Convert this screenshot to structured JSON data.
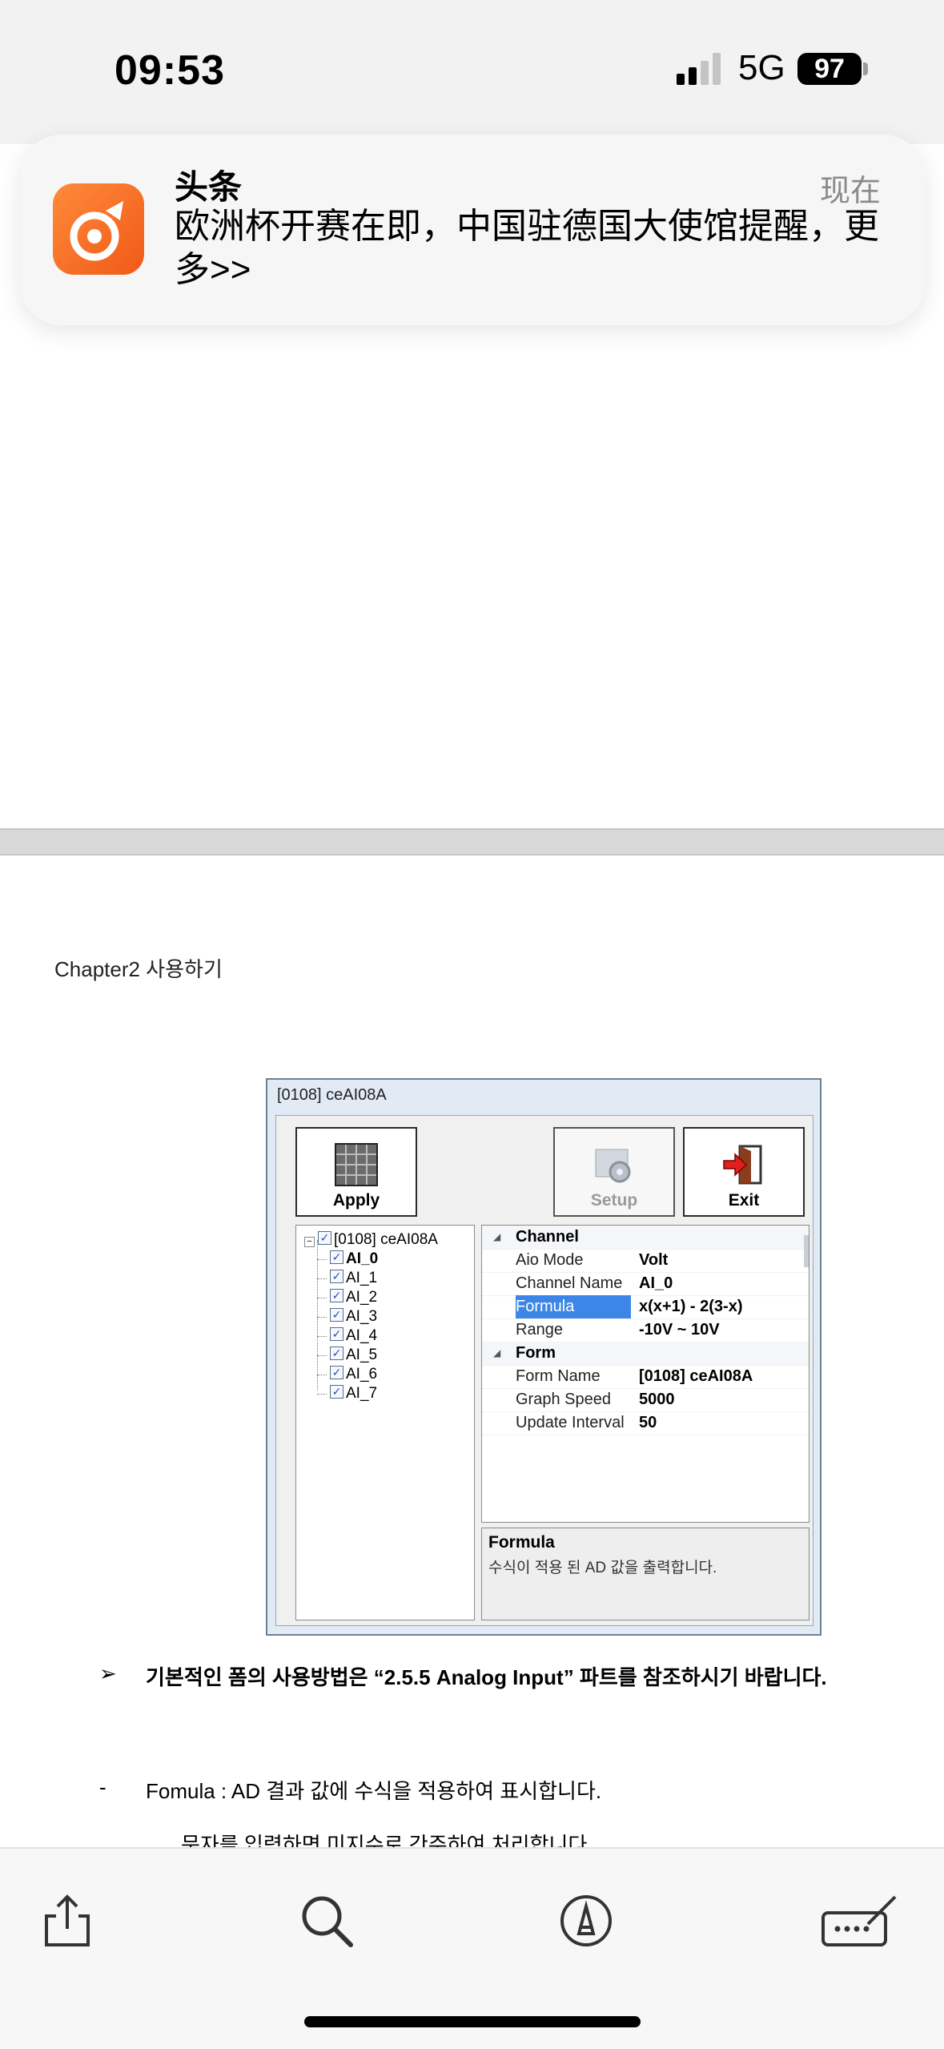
{
  "status_bar": {
    "time": "09:53",
    "network": "5G",
    "battery": "97"
  },
  "notification": {
    "app": "头条",
    "time": "现在",
    "body": "欧洲杯开赛在即，中国驻德国大使馆提醒，更多>>"
  },
  "document": {
    "chapter_header": "Chapter2  사용하기",
    "window": {
      "title": "[0108] ceAI08A",
      "buttons": {
        "apply": "Apply",
        "setup": "Setup",
        "exit": "Exit"
      },
      "tree": {
        "root": "[0108] ceAI08A",
        "items": [
          "AI_0",
          "AI_1",
          "AI_2",
          "AI_3",
          "AI_4",
          "AI_5",
          "AI_6",
          "AI_7"
        ]
      },
      "properties": {
        "channel_category": "Channel",
        "channel": [
          {
            "name": "Aio Mode",
            "value": "Volt"
          },
          {
            "name": "Channel Name",
            "value": "AI_0"
          },
          {
            "name": "Formula",
            "value": "x(x+1) - 2(3-x)"
          },
          {
            "name": "Range",
            "value": "-10V ~ 10V"
          }
        ],
        "form_category": "Form",
        "form": [
          {
            "name": "Form Name",
            "value": "[0108] ceAI08A"
          },
          {
            "name": "Graph Speed",
            "value": "5000"
          },
          {
            "name": "Update Interval",
            "value": "50"
          }
        ]
      },
      "help": {
        "title": "Formula",
        "text": "수식이 적용 된 AD 값을 출력합니다."
      }
    },
    "bullet_arrow": "➢",
    "bold_note": "기본적인 폼의 사용방법은 “2.5.5 Analog Input” 파트를 참조하시기 바랍니다.",
    "dash": "-",
    "formula_desc": "Fomula : AD 결과 값에 수식을 적용하여 표시합니다.",
    "clipped_line": "문자를 입력하면 미지수로 간주하여 처리합니다."
  },
  "colors": {
    "accent": "#3b86e6",
    "app_icon": "#f26a1f"
  },
  "toolbar_icons": [
    "share-icon",
    "search-icon",
    "markup-icon",
    "annotate-icon"
  ]
}
